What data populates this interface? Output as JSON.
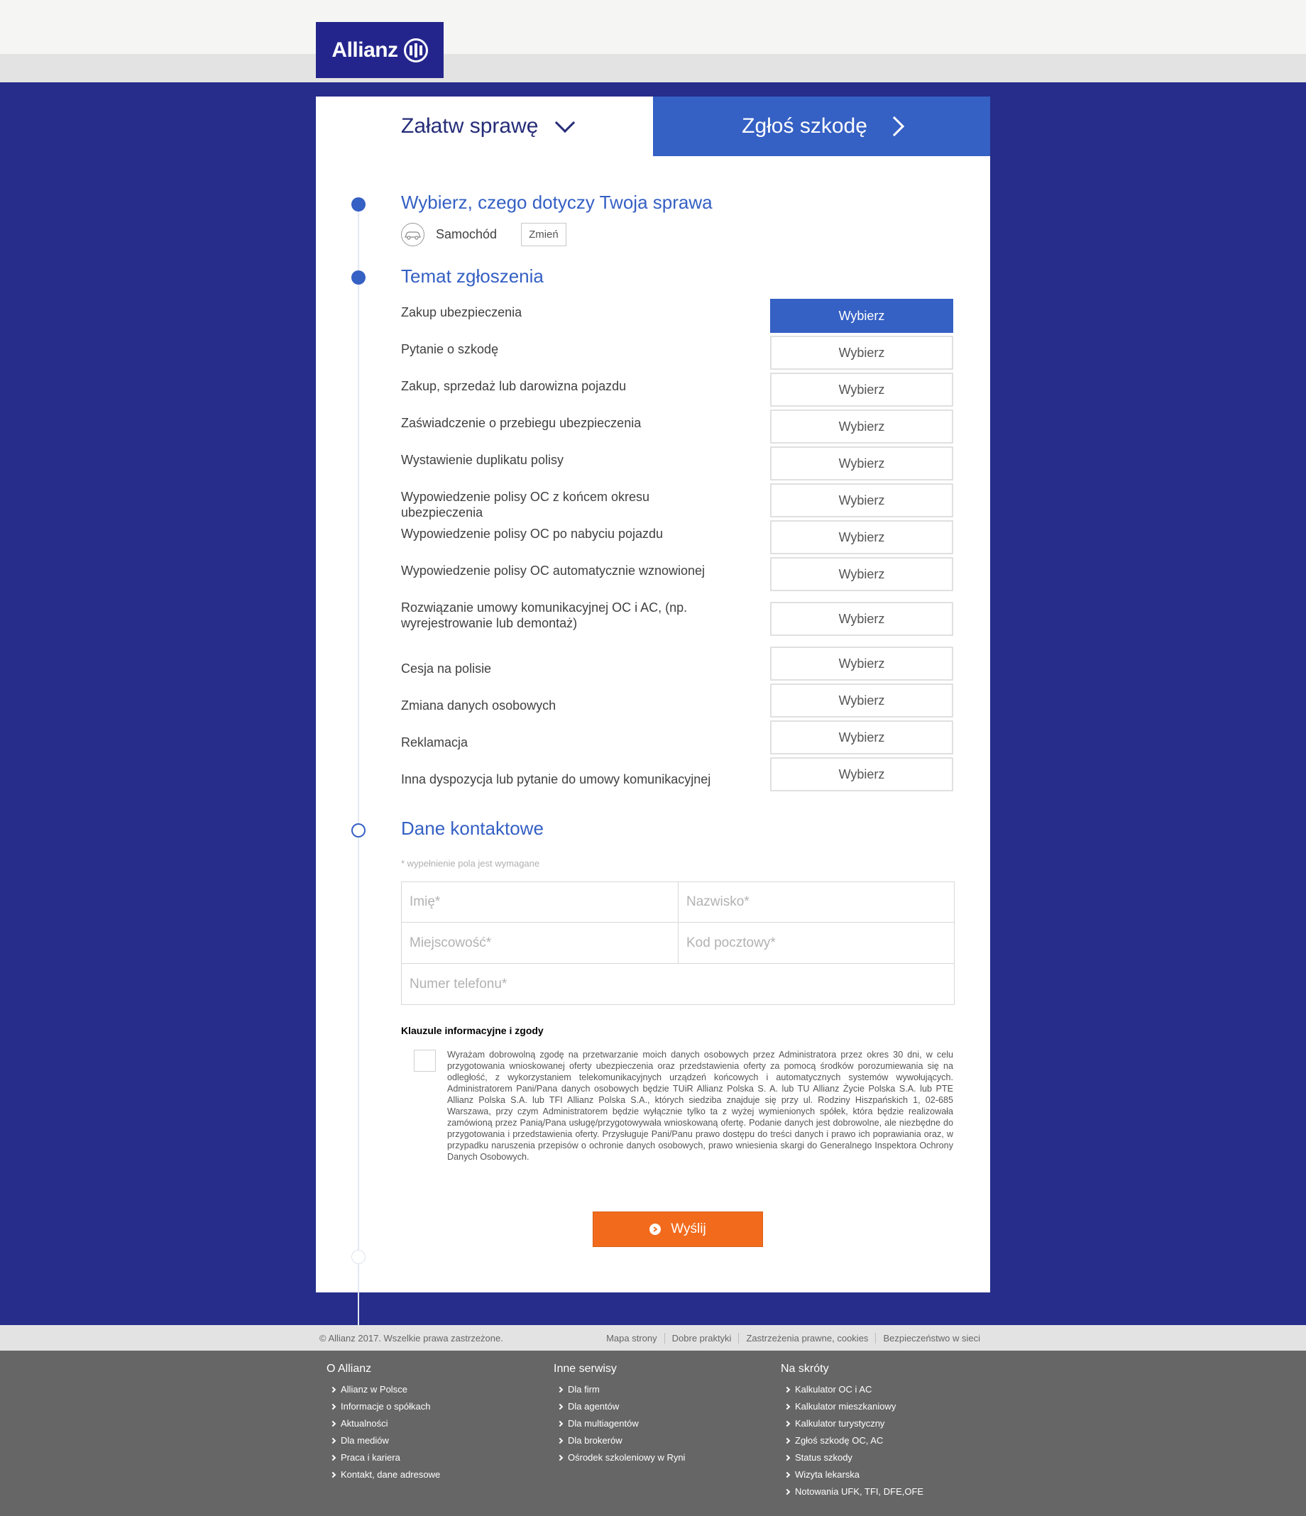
{
  "header": {
    "logo_text": "Allianz"
  },
  "tabs": {
    "left_label": "Załatw sprawę",
    "right_label": "Zgłoś szkodę"
  },
  "step1": {
    "title": "Wybierz, czego dotyczy Twoja sprawa",
    "selected_label": "Samochód",
    "change_label": "Zmień"
  },
  "step2": {
    "title": "Temat zgłoszenia",
    "button_label": "Wybierz",
    "topics": [
      "Zakup ubezpieczenia",
      "Pytanie o szkodę",
      "Zakup, sprzedaż lub darowizna pojazdu",
      "Zaświadczenie o przebiegu ubezpieczenia",
      "Wystawienie duplikatu polisy",
      "Wypowiedzenie polisy OC z końcem okresu ubezpieczenia",
      "Wypowiedzenie polisy OC po nabyciu pojazdu",
      "Wypowiedzenie polisy OC automatycznie wznowionej",
      "Rozwiązanie umowy komunikacyjnej OC i AC, (np. wyrejestrowanie lub demontaż)",
      "Cesja na polisie",
      "Zmiana danych osobowych",
      "Reklamacja",
      "Inna dyspozycja lub pytanie do umowy komunikacyjnej"
    ],
    "selected_index": 0
  },
  "step3": {
    "title": "Dane kontaktowe",
    "required_note": "* wypełnienie pola jest wymagane",
    "fields": {
      "first_name": "Imię*",
      "last_name": "Nazwisko*",
      "city": "Miejscowość*",
      "zip": "Kod pocztowy*",
      "phone": "Numer telefonu*"
    }
  },
  "consent": {
    "title": "Klauzule informacyjne i zgody",
    "text": "Wyrażam dobrowolną zgodę na przetwarzanie moich danych osobowych przez Administratora przez okres 30 dni, w celu przygotowania wnioskowanej oferty ubezpieczenia oraz przedstawienia oferty za pomocą środków porozumiewania się na odległość, z wykorzystaniem telekomunikacyjnych urządzeń końcowych i automatycznych systemów wywołujących. Administratorem Pani/Pana danych osobowych będzie TUiR Allianz Polska S. A. lub TU Allianz Życie Polska S.A. lub PTE Allianz Polska S.A. lub TFI Allianz Polska S.A., których siedziba znajduje się przy ul. Rodziny Hiszpańskich 1, 02-685 Warszawa, przy czym Administratorem będzie wyłącznie tylko ta z wyżej wymienionych spółek, która będzie realizowała zamówioną przez Panią/Pana usługę/przygotowywała wnioskowaną ofertę. Podanie danych jest dobrowolne, ale niezbędne do przygotowania i przedstawienia oferty. Przysługuje Pani/Panu prawo dostępu do treści danych i prawo ich poprawiania oraz, w przypadku naruszenia przepisów o ochronie danych osobowych, prawo wniesienia skargi do Generalnego Inspektora Ochrony Danych Osobowych."
  },
  "submit": {
    "label": "Wyślij"
  },
  "footer_bar": {
    "copyright": "© Allianz 2017. Wszelkie prawa zastrzeżone.",
    "links": [
      "Mapa strony",
      "Dobre praktyki",
      "Zastrzeżenia prawne, cookies",
      "Bezpieczeństwo w sieci"
    ]
  },
  "footer": {
    "columns": [
      {
        "title": "O Allianz",
        "items": [
          "Allianz w Polsce",
          "Informacje o spółkach",
          "Aktualności",
          "Dla mediów",
          "Praca i kariera",
          "Kontakt, dane adresowe"
        ]
      },
      {
        "title": "Inne serwisy",
        "items": [
          "Dla firm",
          "Dla agentów",
          "Dla multiagentów",
          "Dla brokerów",
          "Ośrodek szkoleniowy w Ryni"
        ]
      },
      {
        "title": "Na skróty",
        "items": [
          "Kalkulator OC i AC",
          "Kalkulator mieszkaniowy",
          "Kalkulator turystyczny",
          "Zgłoś szkodę OC, AC",
          "Status szkody",
          "Wizyta lekarska",
          "Notowania UFK, TFI, DFE,OFE"
        ]
      }
    ]
  },
  "colors": {
    "page_background": "#262d8b",
    "accent_blue": "#3560c4",
    "logo_navy": "#24258c",
    "submit_orange": "#f26b1d",
    "footer_gray": "#666666"
  },
  "icons": [
    "logo-mark-icon",
    "chevron-down-icon",
    "chevron-right-icon",
    "car-icon",
    "arrow-circle-icon",
    "footer-chevron-icon"
  ]
}
